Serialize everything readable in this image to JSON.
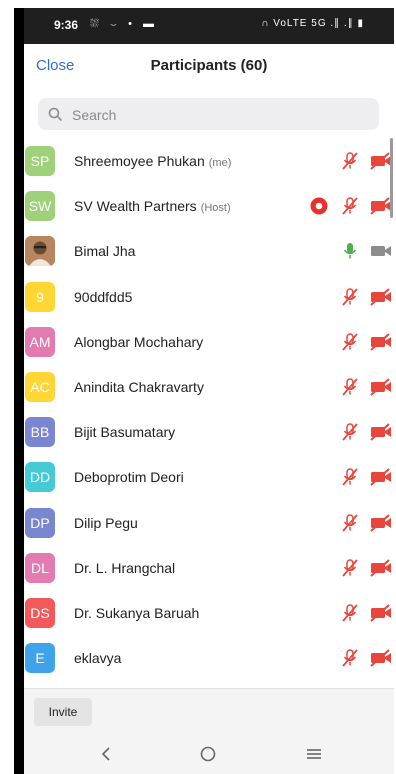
{
  "status_bar": {
    "time": "9:36",
    "left_icons": "⛆ ⌣ • ▬",
    "right_icons": "∩ VoLTE 5G .∥ .∥ ▮"
  },
  "header": {
    "close_label": "Close",
    "title": "Participants (60)"
  },
  "search": {
    "placeholder": "Search"
  },
  "colors": {
    "link": "#2d6fd6",
    "muted_red": "#e8453c",
    "mic_on_green": "#4caf50",
    "record": "#e5322d"
  },
  "participants": [
    {
      "initials": "SP",
      "name": "Shreemoyee Phukan",
      "tag": "(me)",
      "color": "#9fd07a",
      "mic": "muted",
      "video": "off"
    },
    {
      "initials": "SW",
      "name": "SV Wealth Partners",
      "tag": "(Host)",
      "color": "#9fd07a",
      "mic": "muted",
      "video": "off",
      "recording": true
    },
    {
      "initials": "",
      "name": "Bimal Jha",
      "tag": "",
      "color": "#c7a17b",
      "mic": "on",
      "video": "on",
      "photo": true
    },
    {
      "initials": "9",
      "name": "90ddfdd5",
      "tag": "",
      "color": "#ffd633",
      "mic": "muted",
      "video": "off"
    },
    {
      "initials": "AM",
      "name": "Alongbar Mochahary",
      "tag": "",
      "color": "#e37bb0",
      "mic": "muted",
      "video": "off"
    },
    {
      "initials": "AC",
      "name": "Anindita Chakravarty",
      "tag": "",
      "color": "#ffd633",
      "mic": "muted",
      "video": "off"
    },
    {
      "initials": "BB",
      "name": "Bijit Basumatary",
      "tag": "",
      "color": "#7b86d1",
      "mic": "muted",
      "video": "off"
    },
    {
      "initials": "DD",
      "name": "Deboprotim Deori",
      "tag": "",
      "color": "#45cbd6",
      "mic": "muted",
      "video": "off"
    },
    {
      "initials": "DP",
      "name": "Dilip Pegu",
      "tag": "",
      "color": "#7b86d1",
      "mic": "muted",
      "video": "off"
    },
    {
      "initials": "DL",
      "name": "Dr. L. Hrangchal",
      "tag": "",
      "color": "#e37bb0",
      "mic": "muted",
      "video": "off"
    },
    {
      "initials": "DS",
      "name": "Dr. Sukanya Baruah",
      "tag": "",
      "color": "#f1595b",
      "mic": "muted",
      "video": "off"
    },
    {
      "initials": "E",
      "name": "eklavya",
      "tag": "",
      "color": "#3fa3ec",
      "mic": "muted",
      "video": "off"
    },
    {
      "initials": "",
      "name": "",
      "tag": "",
      "color": "#9fd07a",
      "mic": "muted",
      "video": "off"
    }
  ],
  "footer": {
    "invite_label": "Invite"
  },
  "nav": {
    "back_icon": "back-icon",
    "home_icon": "home-icon",
    "menu_icon": "recents-icon"
  }
}
